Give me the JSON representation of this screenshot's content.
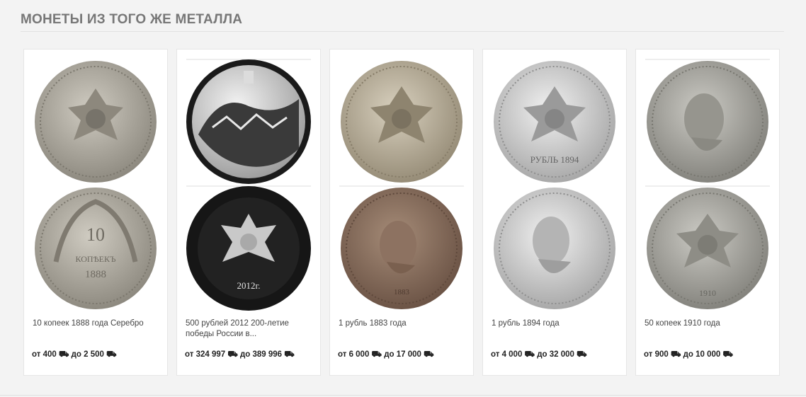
{
  "section": {
    "title": "МОНЕТЫ ИЗ ТОГО ЖЕ МЕТАЛЛА"
  },
  "currency_icon": "ruble-icon",
  "cards": [
    {
      "name": "10 копеек 1888 года Серебро",
      "price": "от 400 ⛟ до 2 500 ⛟",
      "obverse": "eagle-coat-of-arms",
      "reverse": "denomination-wreath",
      "tone": "#b9b5ab"
    },
    {
      "name": "500 рублей 2012 200-летие победы России в...",
      "price": "от 324 997 ⛟ до 389 996 ⛟",
      "obverse": "battle-scene-proof",
      "reverse": "double-headed-eagle-proof",
      "tone": "#1c1c1c"
    },
    {
      "name": "1 рубль 1883 года",
      "price": "от 6 000 ⛟ до 17 000 ⛟",
      "obverse": "eagle-coat-of-arms",
      "reverse": "emperor-portrait",
      "tone": "#b8ad98"
    },
    {
      "name": "1 рубль 1894 года",
      "price": "от 4 000 ⛟ до 32 000 ⛟",
      "obverse": "eagle-coat-of-arms",
      "reverse": "emperor-portrait",
      "tone": "#d6d6d6"
    },
    {
      "name": "50 копеек 1910 года",
      "price": "от 900 ⛟ до 10 000 ⛟",
      "obverse": "emperor-portrait",
      "reverse": "eagle-coat-of-arms",
      "tone": "#aeada7"
    }
  ]
}
